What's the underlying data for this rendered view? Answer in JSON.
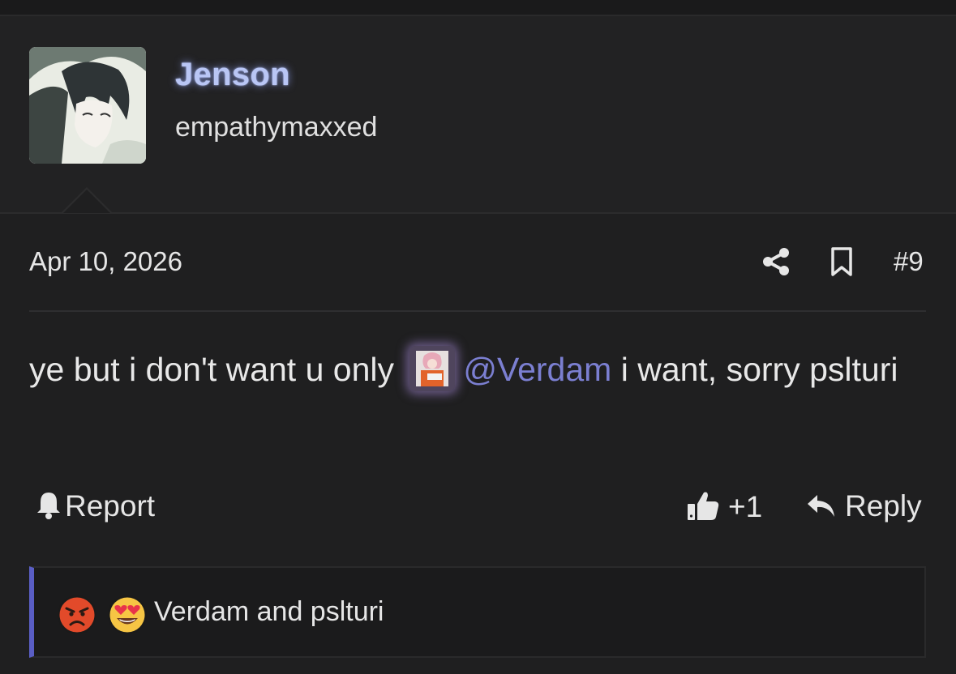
{
  "user": {
    "name": "Jenson",
    "title": "empathymaxxed"
  },
  "post": {
    "date": "Apr 10, 2026",
    "number": "#9",
    "text_before": "ye but i don't want u only ",
    "mention": "@Verdam",
    "text_after": " i want, sorry pslturi"
  },
  "actions": {
    "report": "Report",
    "like_count": "+1",
    "reply": "Reply"
  },
  "reactions": {
    "summary": "Verdam and pslturi",
    "emojis": [
      "angry-face-icon",
      "heart-eyes-icon"
    ]
  },
  "colors": {
    "background": "#1f1f20",
    "username": "#b9c6f5",
    "mention": "#7b7fd1",
    "reaction_accent": "#5a5ec4"
  }
}
